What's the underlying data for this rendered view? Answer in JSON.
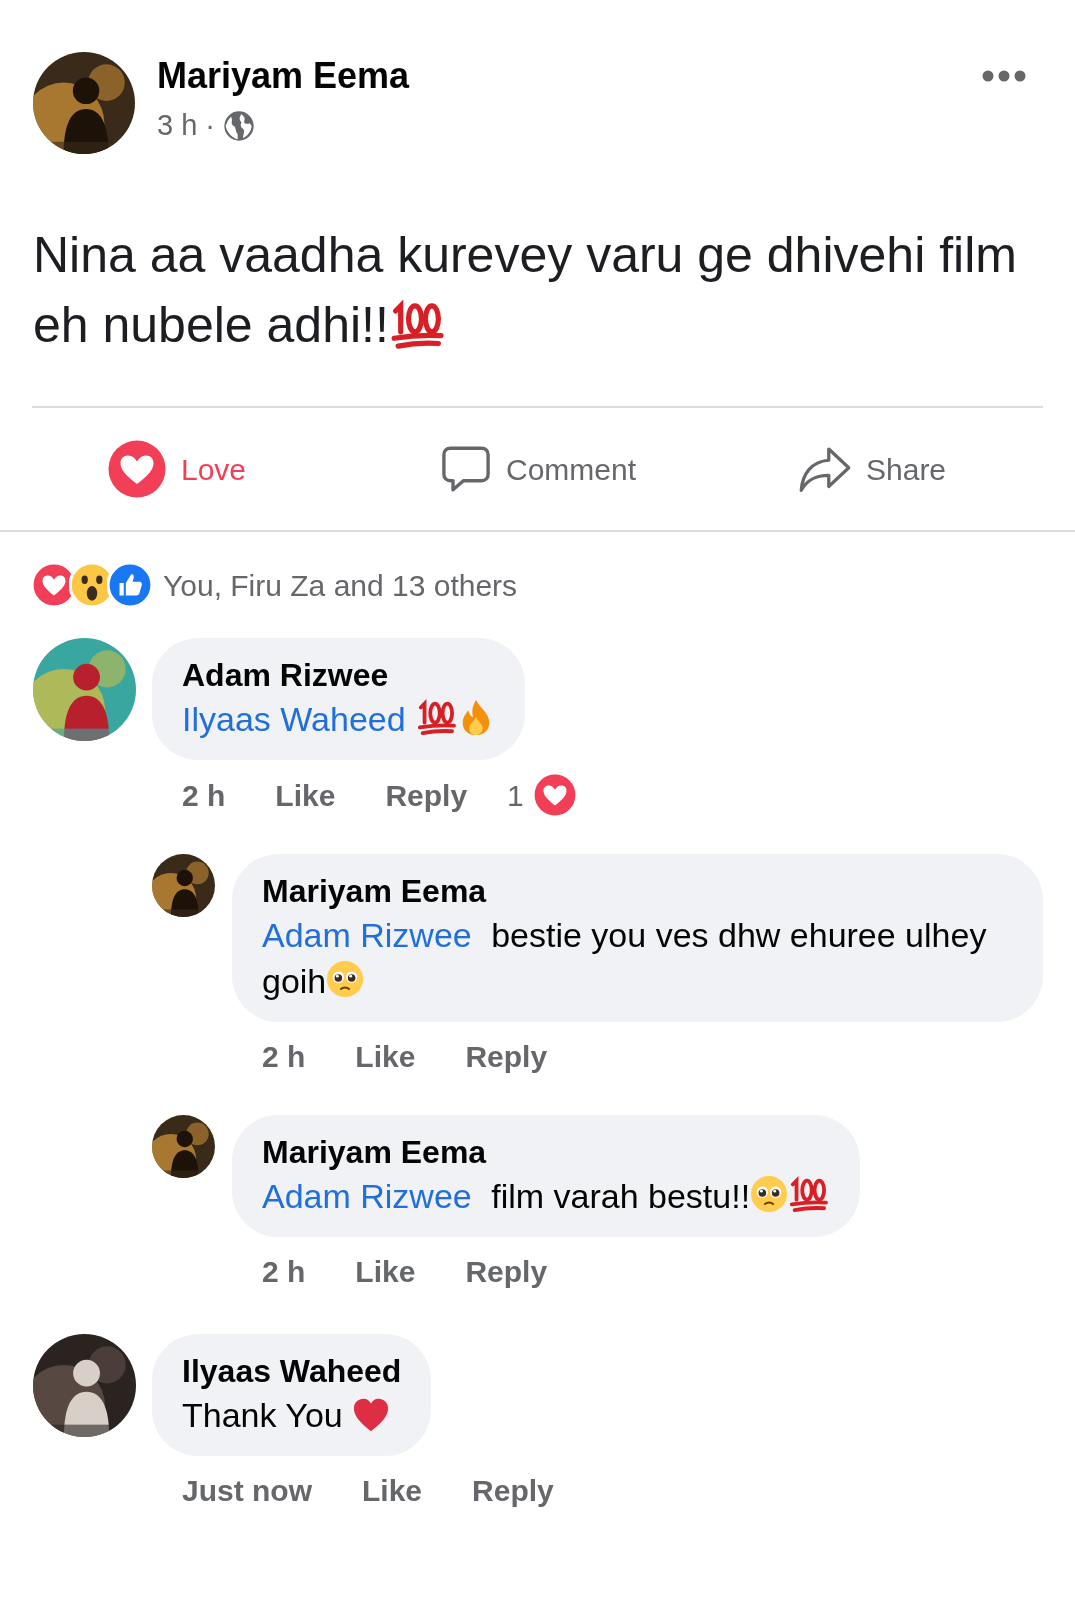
{
  "post": {
    "author": "Mariyam Eema",
    "time": "3 h ·",
    "text": [
      {
        "kind": "text",
        "text": "Nina aa vaadha kurevey varu ge dhivehi film eh nubele adhi!!"
      },
      {
        "kind": "hundred"
      }
    ]
  },
  "actions": [
    {
      "kind": "love",
      "label": "Love",
      "selected": true
    },
    {
      "kind": "comment",
      "label": "Comment",
      "selected": false
    },
    {
      "kind": "share",
      "label": "Share",
      "selected": false
    }
  ],
  "reactions": {
    "icons": [
      {
        "kind": "love"
      },
      {
        "kind": "wow"
      },
      {
        "kind": "like"
      }
    ],
    "summary": "You, Firu Za and 13 others"
  },
  "comments": [
    {
      "author": "Adam Rizwee",
      "reply": false,
      "body": [
        {
          "kind": "mention",
          "text": "Ilyaas Waheed"
        },
        {
          "kind": "hundred"
        },
        {
          "kind": "fire"
        }
      ],
      "time": "2 h",
      "like": "Like",
      "reply_label": "Reply",
      "reaction_count": "1"
    },
    {
      "author": "Mariyam Eema",
      "reply": true,
      "body": [
        {
          "kind": "mention",
          "text": "Adam Rizwee"
        },
        {
          "kind": "text",
          "text": " bestie you ves dhw ehuree ulhey goih"
        },
        {
          "kind": "pleading"
        }
      ],
      "time": "2 h",
      "like": "Like",
      "reply_label": "Reply"
    },
    {
      "author": "Mariyam Eema",
      "reply": true,
      "body": [
        {
          "kind": "mention",
          "text": "Adam Rizwee"
        },
        {
          "kind": "text",
          "text": " film varah bestu!!"
        },
        {
          "kind": "pleading"
        },
        {
          "kind": "hundred"
        }
      ],
      "time": "2 h",
      "like": "Like",
      "reply_label": "Reply"
    },
    {
      "author": "Ilyaas Waheed",
      "reply": false,
      "body": [
        {
          "kind": "text",
          "text": "Thank You "
        },
        {
          "kind": "heart"
        }
      ],
      "time": "Just now",
      "like": "Like",
      "reply_label": "Reply"
    }
  ]
}
